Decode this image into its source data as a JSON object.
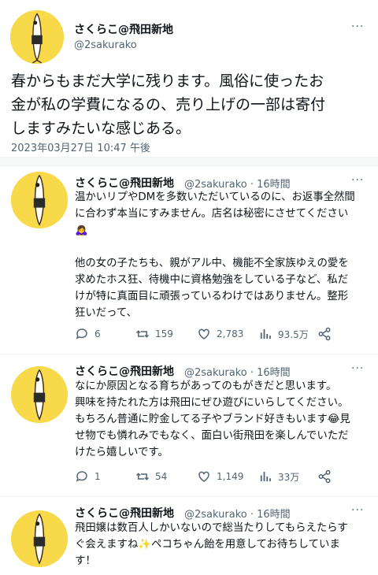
{
  "main_tweet": {
    "name": "さくらこ@飛田新地",
    "handle": "@2sakurako",
    "more": "···",
    "text": "春からもまだ大学に残ります。風俗に使ったお\n金が私の学費になるの、売り上げの一部は寄付\nしますみたいな感じある。",
    "timestamp": "2023年03月27日 10:47 午後"
  },
  "replies": [
    {
      "name": "さくらこ@飛田新地",
      "meta": "@2sakurako · 16時間",
      "more": "···",
      "text": "温かいリプやDMを多数いただいているのに、お返事全然間\nに合わず本当にすみません。店名は秘密にさせてください\n🙇‍♀️\n\n他の女の子たちも、親がアル中、機能不全家族ゆえの愛を\n求めたホス狂、待機中に資格勉強をしている子など、私だ\nけが特に真面目に頑張っているわけではありません。整形\n狂いだって、",
      "replies_count": "6",
      "retweets": "159",
      "likes": "2,783",
      "views": "93.5万"
    },
    {
      "name": "さくらこ@飛田新地",
      "meta": "@2sakurako · 16時間",
      "more": "···",
      "text": "なにか原因となる育ちがあってのもがきだと思います。\n興味を持たれた方は飛田にぜひ遊びにいらしてください。\nもちろん普通に貯金してる子やブランド好きもいます😂見\nせ物でも憐れみでもなく、面白い街飛田を楽しんでいただ\nけたら嬉しいです。",
      "replies_count": "1",
      "retweets": "54",
      "likes": "1,149",
      "views": "33万"
    },
    {
      "name": "さくらこ@飛田新地",
      "meta": "@2sakurako · 16時間",
      "more": "···",
      "text": "飛田嬢は数百人しかいないので総当たりしてもらえたらす\nぐ会えますね✨ペコちゃん飴を用意してお待ちしていま\nす！"
    }
  ],
  "icons": {
    "reply": "comment-icon",
    "retweet": "retweet-icon",
    "like": "heart-icon",
    "views": "bar-chart-icon",
    "share": "share-icon"
  },
  "colors": {
    "avatar_bg": "#f7d94a",
    "text": "#0f1419",
    "secondary": "#536471"
  }
}
